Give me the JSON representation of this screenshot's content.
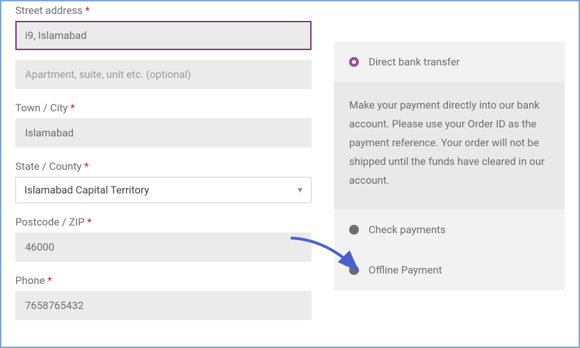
{
  "form": {
    "street": {
      "label": "Street address",
      "value": "i9, Islamabad"
    },
    "apt": {
      "placeholder": "Apartment, suite, unit etc. (optional)",
      "value": ""
    },
    "city": {
      "label": "Town / City",
      "value": "Islamabad"
    },
    "state": {
      "label": "State / County",
      "selected": "Islamabad Capital Territory"
    },
    "postcode": {
      "label": "Postcode / ZIP",
      "value": "46000"
    },
    "phone": {
      "label": "Phone",
      "value": "7658765432"
    }
  },
  "required_marker": "*",
  "payment": {
    "bank": {
      "label": "Direct bank transfer",
      "desc": "Make your payment directly into our bank account. Please use your Order ID as the payment reference. Your order will not be shipped until the funds have cleared in our account."
    },
    "check": {
      "label": "Check payments"
    },
    "offline": {
      "label": "Offline Payment"
    }
  }
}
